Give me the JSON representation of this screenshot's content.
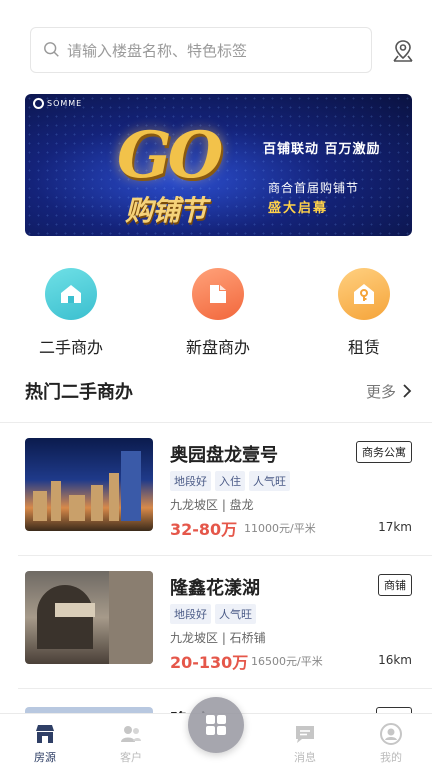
{
  "search": {
    "placeholder": "请输入楼盘名称、特色标签"
  },
  "banner": {
    "brand": "SOMME",
    "headline": "GO",
    "headline_sub": "购铺节",
    "line1": "百铺联动  百万激励",
    "line2": "商合首届购铺节",
    "line3": "盛大启幕"
  },
  "categories": [
    {
      "label": "二手商办",
      "icon": "house-icon",
      "color": "#3bbfcf"
    },
    {
      "label": "新盘商办",
      "icon": "document-icon",
      "color": "#f2673c"
    },
    {
      "label": "租赁",
      "icon": "key-house-icon",
      "color": "#f5a43a"
    }
  ],
  "section": {
    "title": "热门二手商办",
    "more": "更多"
  },
  "listings": [
    {
      "title": "奥园盘龙壹号",
      "type": "商务公寓",
      "tags": [
        "地段好",
        "入住",
        "人气旺"
      ],
      "location": "九龙坡区 | 盘龙",
      "price": "32-80万",
      "unit_price": "11000元/平米",
      "distance": "17km"
    },
    {
      "title": "隆鑫花漾湖",
      "type": "商铺",
      "tags": [
        "地段好",
        "人气旺"
      ],
      "location": "九龙坡区 | 石桥铺",
      "price": "20-130万",
      "unit_price": "16500元/平米",
      "distance": "16km"
    }
  ],
  "peek_listing": {
    "title": "隆     方"
  },
  "tabbar": [
    {
      "label": "房源",
      "icon": "storefront-icon",
      "active": true
    },
    {
      "label": "客户",
      "icon": "users-icon",
      "active": false
    },
    {
      "label": "消息",
      "icon": "message-icon",
      "active": false
    },
    {
      "label": "我的",
      "icon": "profile-icon",
      "active": false
    }
  ],
  "colors": {
    "accent": "#2f3f66",
    "price": "#e5574a",
    "tag_bg": "#eef1f8"
  }
}
